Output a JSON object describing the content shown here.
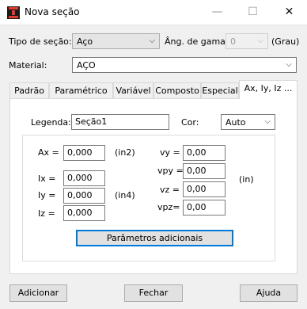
{
  "window": {
    "title": "Nova seção",
    "controls": {
      "minimize": "—",
      "maximize": "☐",
      "close": "✕"
    }
  },
  "top": {
    "section_type_label": "Tipo de seção:",
    "section_type_value": "Aço",
    "gamma_label": "Âng. de gama:",
    "gamma_value": "0",
    "gamma_unit": "(Grau)",
    "material_label": "Material:",
    "material_value": "AÇO"
  },
  "tabs": [
    "Padrão",
    "Paramétrico",
    "Variável",
    "Composto",
    "Especial",
    "Ax, Iy, Iz ..."
  ],
  "panel": {
    "legend_label": "Legenda:",
    "legend_value": "Seção1",
    "color_label": "Cor:",
    "color_value": "Auto",
    "ax_label": "Ax =",
    "ax_value": "0,000",
    "ax_unit": "(in2)",
    "ix_label": "Ix =",
    "ix_value": "0,000",
    "iy_label": "Iy =",
    "iy_value": "0,000",
    "i_unit": "(in4)",
    "iz_label": "Iz =",
    "iz_value": "0,000",
    "vy_label": "vy =",
    "vy_value": "0,00",
    "vpy_label": "vpy =",
    "vpy_value": "0,00",
    "vz_label": "vz =",
    "vz_value": "0,00",
    "vpz_label": "vpz=",
    "vpz_value": "0,00",
    "v_unit": "(in)",
    "params_button": "Parâmetros adicionais"
  },
  "footer": {
    "add": "Adicionar",
    "close": "Fechar",
    "help": "Ajuda"
  },
  "colors": {
    "accent": "#0078d7",
    "icon_red": "#e23b2e"
  }
}
